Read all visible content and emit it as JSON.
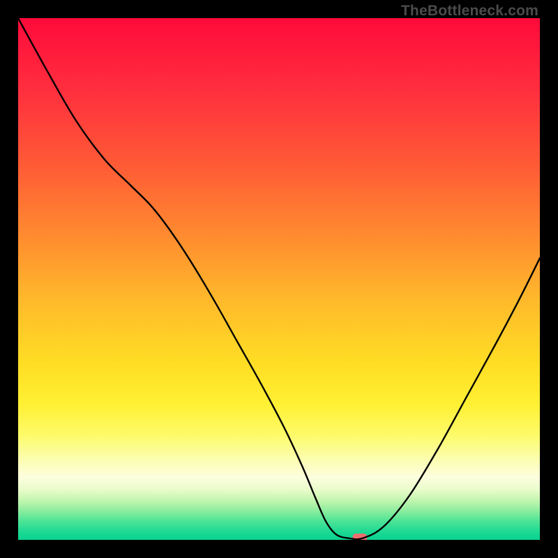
{
  "watermark": "TheBottleneck.com",
  "chart_data": {
    "type": "line",
    "title": "",
    "xlabel": "",
    "ylabel": "",
    "xlim": [
      0,
      1
    ],
    "ylim": [
      0,
      1
    ],
    "grid": false,
    "background_gradient": {
      "type": "vertical",
      "stops": [
        {
          "offset": 0.0,
          "color": "#ff0a3a"
        },
        {
          "offset": 0.14,
          "color": "#ff2f3e"
        },
        {
          "offset": 0.28,
          "color": "#ff5a36"
        },
        {
          "offset": 0.42,
          "color": "#ff8c2f"
        },
        {
          "offset": 0.54,
          "color": "#ffb92b"
        },
        {
          "offset": 0.66,
          "color": "#ffdd24"
        },
        {
          "offset": 0.74,
          "color": "#fff033"
        },
        {
          "offset": 0.8,
          "color": "#fdfb6a"
        },
        {
          "offset": 0.84,
          "color": "#fcfda8"
        },
        {
          "offset": 0.88,
          "color": "#fdfede"
        },
        {
          "offset": 0.905,
          "color": "#e7fbc9"
        },
        {
          "offset": 0.925,
          "color": "#c1f5ae"
        },
        {
          "offset": 0.945,
          "color": "#8aed9e"
        },
        {
          "offset": 0.965,
          "color": "#4ae396"
        },
        {
          "offset": 0.985,
          "color": "#1cd993"
        },
        {
          "offset": 1.0,
          "color": "#09d28e"
        }
      ]
    },
    "series": [
      {
        "name": "bottleneck-curve",
        "color": "#000000",
        "x": [
          0.0,
          0.055,
          0.11,
          0.165,
          0.215,
          0.255,
          0.29,
          0.33,
          0.375,
          0.42,
          0.465,
          0.51,
          0.545,
          0.57,
          0.59,
          0.61,
          0.635,
          0.66,
          0.7,
          0.75,
          0.805,
          0.86,
          0.915,
          0.96,
          1.0
        ],
        "y": [
          1.0,
          0.9,
          0.805,
          0.73,
          0.68,
          0.64,
          0.595,
          0.535,
          0.46,
          0.38,
          0.3,
          0.215,
          0.14,
          0.08,
          0.035,
          0.01,
          0.003,
          0.003,
          0.025,
          0.085,
          0.175,
          0.275,
          0.375,
          0.46,
          0.54
        ]
      }
    ],
    "marker": {
      "name": "bottleneck-marker",
      "x": 0.655,
      "width_frac": 0.028,
      "color": "#ec6f70"
    }
  }
}
